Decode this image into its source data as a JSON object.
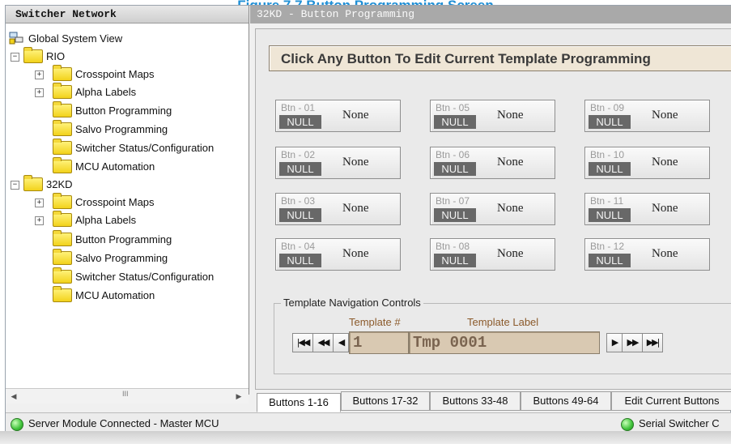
{
  "figure_caption": "Figure 7.7 Button Programming Screen",
  "left_pane": {
    "title": "Switcher Network",
    "root": "Global System View",
    "groups": [
      {
        "name": "RIO",
        "items": [
          "Crosspoint Maps",
          "Alpha Labels",
          "Button Programming",
          "Salvo Programming",
          "Switcher Status/Configuration",
          "MCU Automation"
        ]
      },
      {
        "name": "32KD",
        "items": [
          "Crosspoint Maps",
          "Alpha Labels",
          "Button Programming",
          "Salvo Programming",
          "Switcher Status/Configuration",
          "MCU Automation"
        ]
      }
    ],
    "scroll_grip": "III"
  },
  "right_pane": {
    "title": "32KD - Button Programming",
    "header": "Click Any Button To Edit Current Template Programming",
    "buttons": [
      {
        "num": "Btn - 01",
        "tag": "NULL",
        "name": "None"
      },
      {
        "num": "Btn - 02",
        "tag": "NULL",
        "name": "None"
      },
      {
        "num": "Btn - 03",
        "tag": "NULL",
        "name": "None"
      },
      {
        "num": "Btn - 04",
        "tag": "NULL",
        "name": "None"
      },
      {
        "num": "Btn - 05",
        "tag": "NULL",
        "name": "None"
      },
      {
        "num": "Btn - 06",
        "tag": "NULL",
        "name": "None"
      },
      {
        "num": "Btn - 07",
        "tag": "NULL",
        "name": "None"
      },
      {
        "num": "Btn - 08",
        "tag": "NULL",
        "name": "None"
      },
      {
        "num": "Btn - 09",
        "tag": "NULL",
        "name": "None"
      },
      {
        "num": "Btn - 10",
        "tag": "NULL",
        "name": "None"
      },
      {
        "num": "Btn - 11",
        "tag": "NULL",
        "name": "None"
      },
      {
        "num": "Btn - 12",
        "tag": "NULL",
        "name": "None"
      }
    ],
    "nav": {
      "legend": "Template Navigation Controls",
      "template_num_caption": "Template #",
      "template_label_caption": "Template Label",
      "template_num": "1",
      "template_label": "Tmp 0001",
      "first": "|◀◀",
      "prev_fast": "◀◀",
      "prev": "◀",
      "next": "▶",
      "next_fast": "▶▶",
      "last": "▶▶|"
    },
    "tabs": [
      "Buttons 1-16",
      "Buttons 17-32",
      "Buttons 33-48",
      "Buttons 49-64",
      "Edit Current Buttons"
    ]
  },
  "status": {
    "left": "Server Module Connected - Master MCU",
    "right": "Serial Switcher C",
    "led_color": "#3fc23a"
  }
}
